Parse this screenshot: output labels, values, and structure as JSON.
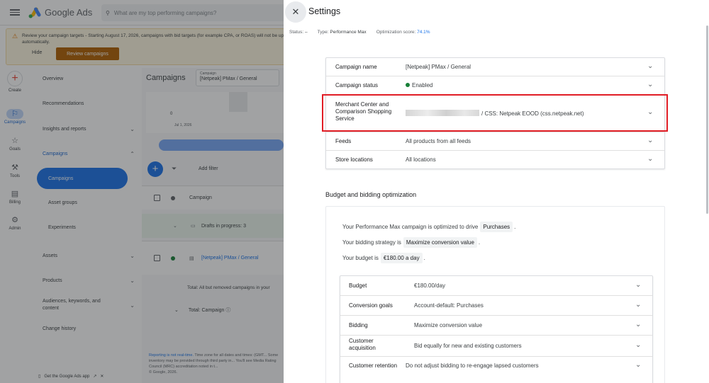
{
  "app": {
    "name": "Google Ads"
  },
  "search": {
    "placeholder": "What are my top performing campaigns?"
  },
  "banner": {
    "text": "Review your campaign targets - Starting August 17, 2026, campaigns with bid targets (for example CPA, or ROAS) will not be updated automatically.",
    "hide_label": "Hide",
    "review_label": "Review campaigns"
  },
  "rail": {
    "create": "Create",
    "campaigns": "Campaigns",
    "goals": "Goals",
    "tools": "Tools",
    "billing": "Billing",
    "admin": "Admin"
  },
  "nav": {
    "overview": "Overview",
    "recommendations": "Recommendations",
    "insights": "Insights and reports",
    "campaigns_group": "Campaigns",
    "campaigns": "Campaigns",
    "asset_groups": "Asset groups",
    "experiments": "Experiments",
    "assets": "Assets",
    "products": "Products",
    "audiences": "Audiences, keywords, and content",
    "change_history": "Change history",
    "footer_app": "Get the Google Ads app"
  },
  "main": {
    "title": "Campaigns",
    "chip_label": "Campaign",
    "chip_value": "[Netpeak] PMax / General",
    "chart_zero": "0",
    "chart_date": "Jul 1, 2026",
    "add_filter": "Add filter",
    "col_campaign": "Campaign",
    "drafts": "Drafts in progress: 3",
    "campaign_link": "[Netpeak] PMax / General",
    "totals_all": "Total: All but removed campaigns in your",
    "totals_campaign": "Total: Campaign",
    "footnote_link": "Reporting is not real-time.",
    "footnote_text": "Time zone for all dates and times: (GMT... Some inventory may be provided through third party in... You'll see Media Rating Council (MRC) accreditation noted in t...",
    "copyright": "© Google, 2026."
  },
  "settings": {
    "title": "Settings",
    "status_label": "Status:",
    "status_value": "–",
    "type_label": "Type:",
    "type_value": "Performance Max",
    "score_label": "Optimization score:",
    "score_value": "74.1%",
    "rows": [
      {
        "label": "Campaign name",
        "value": "[Netpeak] PMax / General"
      },
      {
        "label": "Campaign status",
        "value": "Enabled"
      },
      {
        "label": "Merchant Center and Comparison Shopping Service",
        "value": "/ CSS: Netpeak EOOD (css.netpeak.net)"
      },
      {
        "label": "Feeds",
        "value": "All products from all feeds"
      },
      {
        "label": "Store locations",
        "value": "All locations"
      }
    ],
    "budget_section_title": "Budget and bidding optimization",
    "sentence1_prefix": "Your Performance Max campaign is optimized to drive",
    "sentence1_chip": "Purchases",
    "sentence2_prefix": "Your bidding strategy is",
    "sentence2_chip": "Maximize conversion value",
    "sentence3_prefix": "Your budget is",
    "sentence3_chip": "€180.00 a day",
    "period": ".",
    "inner_rows": [
      {
        "label": "Budget",
        "value": "€180.00/day"
      },
      {
        "label": "Conversion goals",
        "value": "Account-default: Purchases"
      },
      {
        "label": "Bidding",
        "value": "Maximize conversion value"
      },
      {
        "label": "Customer acquisition",
        "value": "Bid equally for new and existing customers"
      },
      {
        "label": "Customer retention",
        "value": "Do not adjust bidding to re-engage lapsed customers"
      }
    ]
  }
}
